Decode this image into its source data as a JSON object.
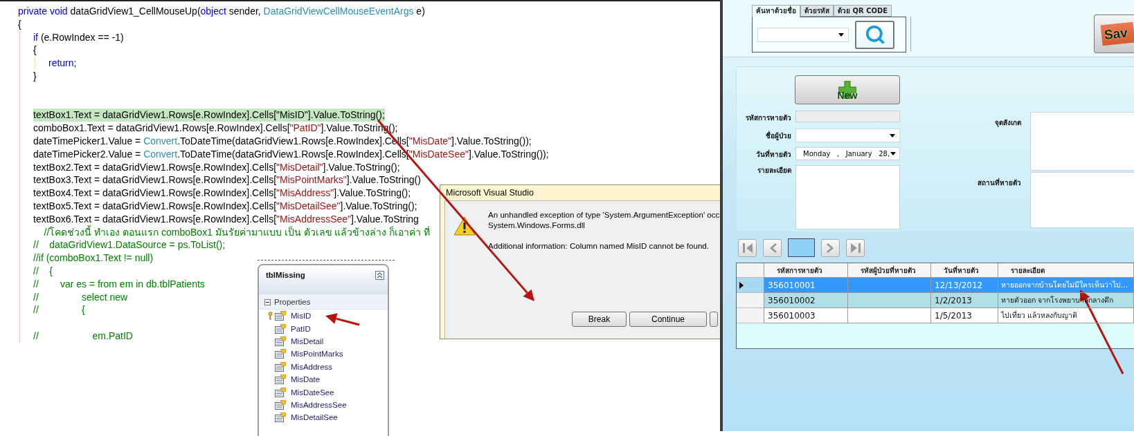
{
  "code_editor": {
    "lines": [
      {
        "kind": "code",
        "highlighted": false,
        "tokens": [
          {
            "kind": "keyword",
            "text": "private void"
          },
          {
            "kind": "plain",
            "text": " dataGridView1_CellMouseUp("
          },
          {
            "kind": "keyword",
            "text": "object"
          },
          {
            "kind": "plain",
            "text": " sender, "
          },
          {
            "kind": "type",
            "text": "DataGridViewCellMouseEventArgs"
          },
          {
            "kind": "plain",
            "text": " e)"
          }
        ]
      },
      {
        "kind": "code",
        "highlighted": false,
        "tokens": [
          {
            "kind": "plain",
            "text": "{"
          }
        ],
        "children": [
          {
            "kind": "code",
            "highlighted": false,
            "tokens": [
              {
                "kind": "keyword",
                "text": "if"
              },
              {
                "kind": "plain",
                "text": " (e.RowIndex == -1)"
              }
            ]
          },
          {
            "kind": "code",
            "highlighted": false,
            "tokens": [
              {
                "kind": "plain",
                "text": "{"
              }
            ],
            "children": [
              {
                "kind": "code",
                "highlighted": false,
                "tokens": [
                  {
                    "kind": "keyword",
                    "text": "return"
                  },
                  {
                    "kind": "plain",
                    "text": ";"
                  }
                ]
              }
            ]
          },
          {
            "kind": "code",
            "highlighted": false,
            "tokens": [
              {
                "kind": "plain",
                "text": "}"
              }
            ]
          },
          {
            "kind": "blank"
          },
          {
            "kind": "blank"
          },
          {
            "kind": "code",
            "highlighted": true,
            "tokens": [
              {
                "kind": "plain",
                "text": "textBox1.Text = dataGridView1.Rows[e.RowIndex].Cells["
              },
              {
                "kind": "plain",
                "text": "\"MisID\""
              },
              {
                "kind": "plain",
                "text": "].Value.ToString();"
              }
            ]
          },
          {
            "kind": "code",
            "highlighted": false,
            "tokens": [
              {
                "kind": "plain",
                "text": "comboBox1.Text = dataGridView1.Rows[e.RowIndex].Cells["
              },
              {
                "kind": "string",
                "text": "\"PatID\""
              },
              {
                "kind": "plain",
                "text": "].Value.ToString();"
              }
            ]
          },
          {
            "kind": "code",
            "highlighted": false,
            "tokens": [
              {
                "kind": "plain",
                "text": "dateTimePicker1.Value = "
              },
              {
                "kind": "type",
                "text": "Convert"
              },
              {
                "kind": "plain",
                "text": ".ToDateTime(dataGridView1.Rows[e.RowIndex].Cells["
              },
              {
                "kind": "string",
                "text": "\"MisDate\""
              },
              {
                "kind": "plain",
                "text": "].Value.ToString());"
              }
            ]
          },
          {
            "kind": "code",
            "highlighted": false,
            "tokens": [
              {
                "kind": "plain",
                "text": "dateTimePicker2.Value = "
              },
              {
                "kind": "type",
                "text": "Convert"
              },
              {
                "kind": "plain",
                "text": ".ToDateTime(dataGridView1.Rows[e.RowIndex].Cells["
              },
              {
                "kind": "string",
                "text": "\"MisDateSee\""
              },
              {
                "kind": "plain",
                "text": "].Value.ToString());"
              }
            ]
          },
          {
            "kind": "code",
            "highlighted": false,
            "tokens": [
              {
                "kind": "plain",
                "text": "textBox2.Text = dataGridView1.Rows[e.RowIndex].Cells["
              },
              {
                "kind": "string",
                "text": "\"MisDetail\""
              },
              {
                "kind": "plain",
                "text": "].Value.ToString();"
              }
            ]
          },
          {
            "kind": "code",
            "highlighted": false,
            "tokens": [
              {
                "kind": "plain",
                "text": "textBox3.Text = dataGridView1.Rows[e.RowIndex].Cells["
              },
              {
                "kind": "string",
                "text": "\"MisPointMarks\""
              },
              {
                "kind": "plain",
                "text": "].Value.ToString()"
              }
            ]
          },
          {
            "kind": "code",
            "highlighted": false,
            "tokens": [
              {
                "kind": "plain",
                "text": "textBox4.Text = dataGridView1.Rows[e.RowIndex].Cells["
              },
              {
                "kind": "string",
                "text": "\"MisAddress\""
              },
              {
                "kind": "plain",
                "text": "].Value.ToString();"
              }
            ]
          },
          {
            "kind": "code",
            "highlighted": false,
            "tokens": [
              {
                "kind": "plain",
                "text": "textBox5.Text = dataGridView1.Rows[e.RowIndex].Cells["
              },
              {
                "kind": "string",
                "text": "\"MisDetailSee\""
              },
              {
                "kind": "plain",
                "text": "].Value.ToString();"
              }
            ]
          },
          {
            "kind": "code",
            "highlighted": false,
            "tokens": [
              {
                "kind": "plain",
                "text": "textBox6.Text = dataGridView1.Rows[e.RowIndex].Cells["
              },
              {
                "kind": "string",
                "text": "\"MisAddressSee\""
              },
              {
                "kind": "plain",
                "text": "].Value.ToString"
              }
            ]
          },
          {
            "kind": "code",
            "highlighted": false,
            "tokens": [
              {
                "kind": "comment",
                "text": "    //โคดช่วงนี้ ทำเอง ตอนแรก comboBox1 มันรัยค่ามาแบบ เป็น ตัวเลข แล้วข้างล่าง ก็เอาค่า ที่"
              }
            ]
          },
          {
            "kind": "code",
            "highlighted": false,
            "tokens": [
              {
                "kind": "comment",
                "text": "//    dataGridView1.DataSource = ps.ToList();"
              }
            ]
          },
          {
            "kind": "code",
            "highlighted": false,
            "tokens": [
              {
                "kind": "comment",
                "text": "//if (comboBox1.Text != null)"
              }
            ]
          },
          {
            "kind": "code",
            "highlighted": false,
            "tokens": [
              {
                "kind": "comment",
                "text": "//    {"
              }
            ]
          },
          {
            "kind": "code",
            "highlighted": false,
            "tokens": [
              {
                "kind": "comment",
                "text": "//        var es = from em in db.tblPatients"
              }
            ]
          },
          {
            "kind": "code",
            "highlighted": false,
            "tokens": [
              {
                "kind": "comment",
                "text": "//                select new"
              }
            ]
          },
          {
            "kind": "code",
            "highlighted": false,
            "tokens": [
              {
                "kind": "comment",
                "text": "//                {"
              }
            ]
          },
          {
            "kind": "blank"
          },
          {
            "kind": "code",
            "highlighted": false,
            "tokens": [
              {
                "kind": "comment",
                "text": "//                    em.PatID"
              }
            ]
          }
        ]
      }
    ]
  },
  "error_dialog": {
    "title": "Microsoft Visual Studio",
    "message_lines": [
      "An unhandled exception of type 'System.ArgumentException' occ",
      "System.Windows.Forms.dll"
    ],
    "details": "Additional information: Column named MisID cannot be found.",
    "buttons": [
      {
        "label": "Break"
      },
      {
        "label": "Continue"
      }
    ],
    "partial_button": true
  },
  "entity_diagram": {
    "title": "tblMissing",
    "section": "Properties",
    "expanded": true,
    "properties": [
      {
        "name": "MisID",
        "key": true
      },
      {
        "name": "PatID",
        "key": false
      },
      {
        "name": "MisDetail",
        "key": false
      },
      {
        "name": "MisPointMarks",
        "key": false
      },
      {
        "name": "MisAddress",
        "key": false
      },
      {
        "name": "MisDate",
        "key": false
      },
      {
        "name": "MisDateSee",
        "key": false
      },
      {
        "name": "MisAddressSee",
        "key": false
      },
      {
        "name": "MisDetailSee",
        "key": false
      }
    ]
  },
  "form": {
    "search_tabs": [
      {
        "label": "ค้นหาด้วยชื่อ",
        "selected": true
      },
      {
        "label": "ด้วยรหัส",
        "selected": false
      },
      {
        "label": "ด้วย QR CODE",
        "selected": false
      }
    ],
    "save_button": {
      "label": "Sav"
    },
    "new_button": {
      "label": "New"
    },
    "left_fields": [
      {
        "label": "รหัสการหายตัว",
        "kind": "readonly"
      },
      {
        "label": "ชื่อผู้ป่วย",
        "kind": "combo"
      },
      {
        "label": "วันที่หายตัว",
        "kind": "date",
        "value": "Monday   ,   January   28,"
      },
      {
        "label": "รายละเอียด",
        "kind": "textarea"
      }
    ],
    "right_fields": [
      {
        "label": "จุดสังเกต"
      },
      {
        "label": "สถานที่หายตัว"
      }
    ],
    "grid": {
      "columns": [
        "รหัสการหายตัว",
        "รหัสผู้ป่วยที่หายตัว",
        "วันที่หายตัว",
        "รายละเอียด"
      ],
      "rows": [
        {
          "selected": true,
          "cells": [
            "356010001",
            "",
            "12/13/2012",
            "หายออกจากบ้านโดยไม่มีใครเห็นว่าไป..."
          ]
        },
        {
          "selected": false,
          "cells": [
            "356010002",
            "",
            "1/2/2013",
            "หายตัวออก จากโรงพยาบาลกลางดึก"
          ]
        },
        {
          "selected": false,
          "cells": [
            "356010003",
            "",
            "1/5/2013",
            "ไปเที่ยว แล้วหลงกับญาติ"
          ]
        }
      ]
    }
  }
}
